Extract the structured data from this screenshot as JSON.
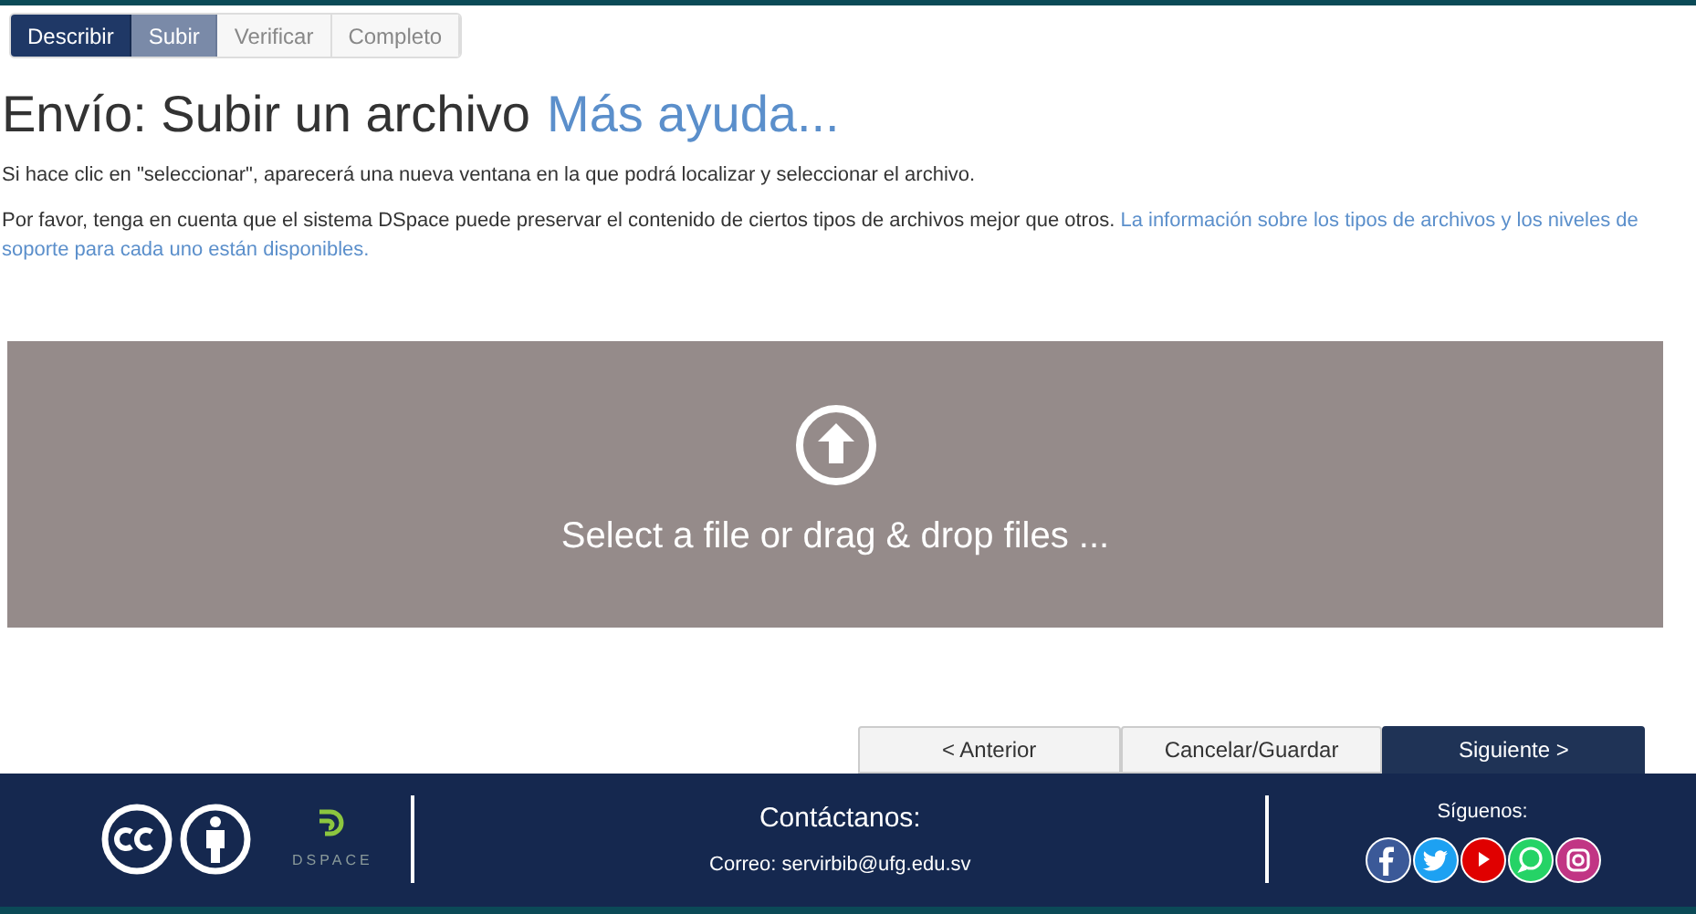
{
  "steps": [
    {
      "label": "Describir",
      "selected": false,
      "completed": true
    },
    {
      "label": "Subir",
      "selected": true,
      "completed": false
    },
    {
      "label": "Verificar",
      "selected": false,
      "completed": false
    },
    {
      "label": "Completo",
      "selected": false,
      "completed": false
    }
  ],
  "heading": {
    "title": "Envío: Subir un archivo",
    "help_link": "Más ayuda..."
  },
  "instructions": "Si hace clic en \"seleccionar\", aparecerá una nueva ventana en la que podrá localizar y seleccionar el archivo.",
  "note": {
    "text": "Por favor, tenga en cuenta que el sistema DSpace puede preservar el contenido de ciertos tipos de archivos mejor que otros.",
    "link": "La información sobre los tipos de archivos y los niveles de soporte para cada uno están disponibles."
  },
  "dropzone": {
    "label": "Select a file or drag & drop files ..."
  },
  "buttons": [
    {
      "label": "< Anterior",
      "kind": "secondary"
    },
    {
      "label": "Cancelar/Guardar",
      "kind": "secondary"
    },
    {
      "label": "Siguiente >",
      "kind": "primary"
    }
  ],
  "footer": {
    "logo_text": "DSPACE",
    "contact_title": "Contáctanos:",
    "contact_email": "Correo: servirbib@ufg.edu.sv",
    "social_title": "Síguenos:"
  }
}
